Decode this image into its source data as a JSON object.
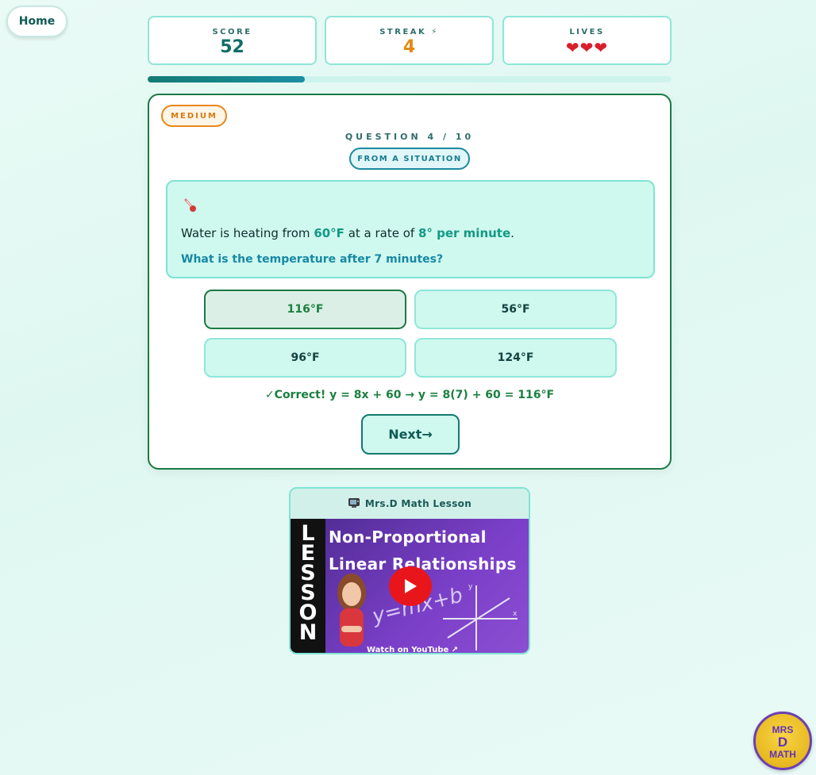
{
  "nav": {
    "home_label": "Home"
  },
  "stats": {
    "score_label": "SCORE",
    "score_value": "52",
    "streak_label": "STREAK ⚡",
    "streak_value": "4",
    "lives_label": "LIVES",
    "lives_value": "❤❤❤"
  },
  "progress": {
    "fraction": 0.3
  },
  "question": {
    "difficulty": "MEDIUM",
    "number_label": "QUESTION 4 / 10",
    "type": "FROM A SITUATION",
    "icon": "thermometer-icon",
    "statement_prefix": "Water is heating from ",
    "statement_temp": "60°F",
    "statement_mid": " at a rate of ",
    "statement_rate": "8° per minute",
    "statement_suffix": ".",
    "ask": "What is the temperature after 7 minutes?"
  },
  "choices": [
    {
      "label": "116°F",
      "state": "correct"
    },
    {
      "label": "56°F",
      "state": "default"
    },
    {
      "label": "96°F",
      "state": "default"
    },
    {
      "label": "124°F",
      "state": "default"
    }
  ],
  "feedback": "✓Correct! y = 8x + 60 → y = 8(7) + 60 = 116°F",
  "next_label": "Next→",
  "video": {
    "header_icon": "tv-icon",
    "header": "Mrs.D Math Lesson",
    "strip_text": "LESSON",
    "title_line1": "Non-Proportional",
    "title_line2": "Linear Relationships",
    "equation": "y=mx+b",
    "watch_label": "Watch on YouTube ↗"
  },
  "brand": {
    "text": "MRS D MATH"
  }
}
